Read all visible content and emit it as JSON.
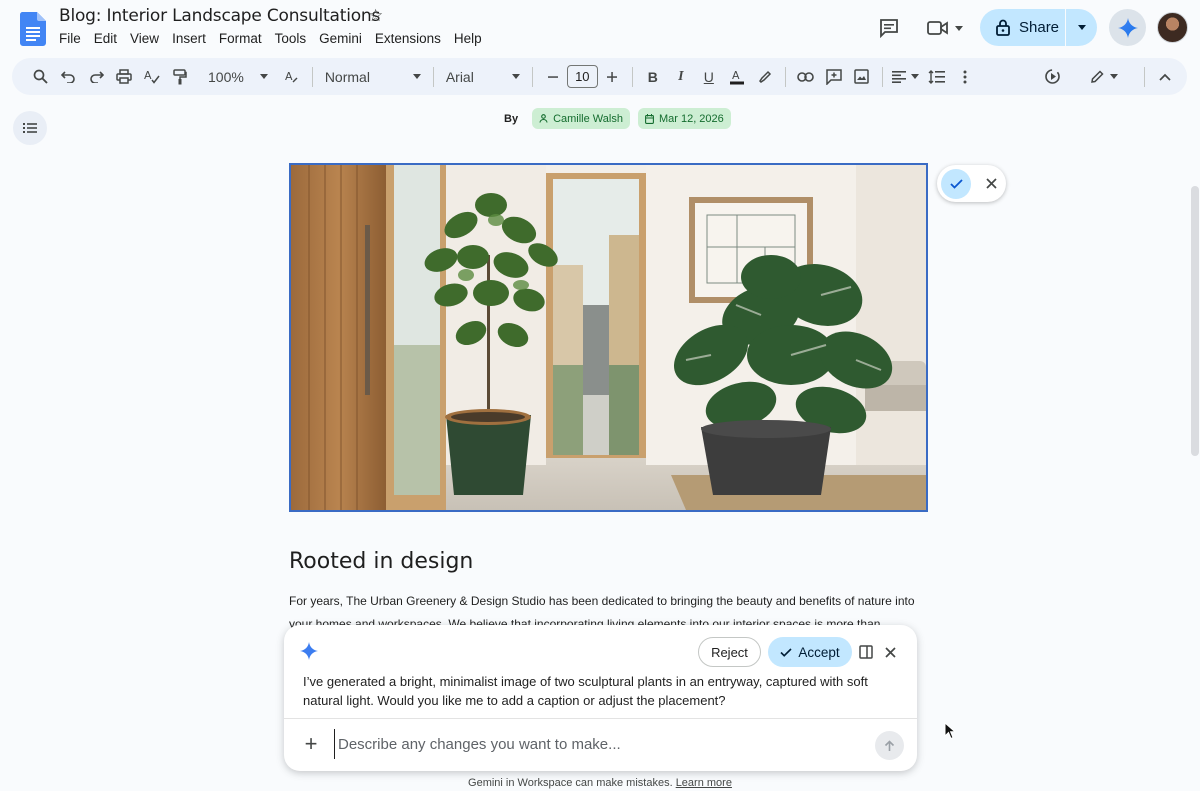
{
  "document": {
    "title": "Blog: Interior Landscape Consultations"
  },
  "menu": [
    "File",
    "Edit",
    "View",
    "Insert",
    "Format",
    "Tools",
    "Gemini",
    "Extensions",
    "Help"
  ],
  "share": {
    "label": "Share"
  },
  "toolbar": {
    "zoom": "100%",
    "style": "Normal",
    "font": "Arial",
    "font_size": "10"
  },
  "byline": {
    "by_label": "By",
    "author": "Camille Walsh",
    "date": "Mar 12, 2026"
  },
  "body": {
    "heading": "Rooted in design",
    "paragraph": "For years, The Urban Greenery & Design Studio has been dedicated to bringing the beauty and benefits of nature into your homes and workspaces. We believe that incorporating living elements into our interior spaces is more than"
  },
  "gemini_panel": {
    "reject_label": "Reject",
    "accept_label": "Accept",
    "message": "I’ve generated a bright, minimalist image of two sculptural plants in an entryway, captured with soft natural light. Would you like me to add a caption or adjust the placement?",
    "input_placeholder": "Describe any changes you want to make..."
  },
  "disclaimer": {
    "text": "Gemini in Workspace can make mistakes.",
    "link": "Learn more"
  },
  "colors": {
    "accent_blue": "#c2e7ff",
    "toolbar_bg": "#edf2fa",
    "chip_green": "#cdeed3",
    "image_border": "#3a6bc4"
  }
}
